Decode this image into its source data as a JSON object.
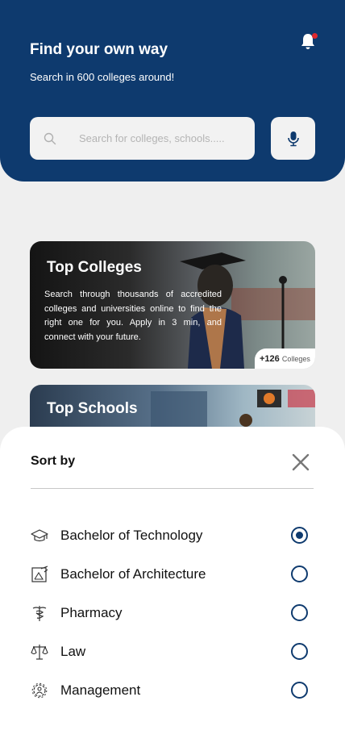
{
  "header": {
    "title": "Find your own way",
    "subtitle": "Search in 600 colleges around!"
  },
  "search": {
    "placeholder": "Search for colleges, schools.....",
    "mic_icon": "mic-icon",
    "search_icon": "search-icon",
    "notification_icon": "bell-icon"
  },
  "cards": [
    {
      "title": "Top Colleges",
      "description": "Search through thousands of accredited colleges and universities online to find the right one for you.  Apply in 3 min, and connect with your future.",
      "badge_count": "+126",
      "badge_label": "Colleges"
    },
    {
      "title": "Top Schools"
    }
  ],
  "sort_sheet": {
    "title": "Sort by",
    "options": [
      {
        "label": "Bachelor of Technology",
        "icon": "graduation-cap-icon",
        "selected": true
      },
      {
        "label": "Bachelor of Architecture",
        "icon": "drafting-icon",
        "selected": false
      },
      {
        "label": "Pharmacy",
        "icon": "caduceus-icon",
        "selected": false
      },
      {
        "label": "Law",
        "icon": "scales-icon",
        "selected": false
      },
      {
        "label": "Management",
        "icon": "gear-people-icon",
        "selected": false
      }
    ]
  },
  "colors": {
    "primary": "#0e3a6e",
    "notification_dot": "#e0282e"
  }
}
